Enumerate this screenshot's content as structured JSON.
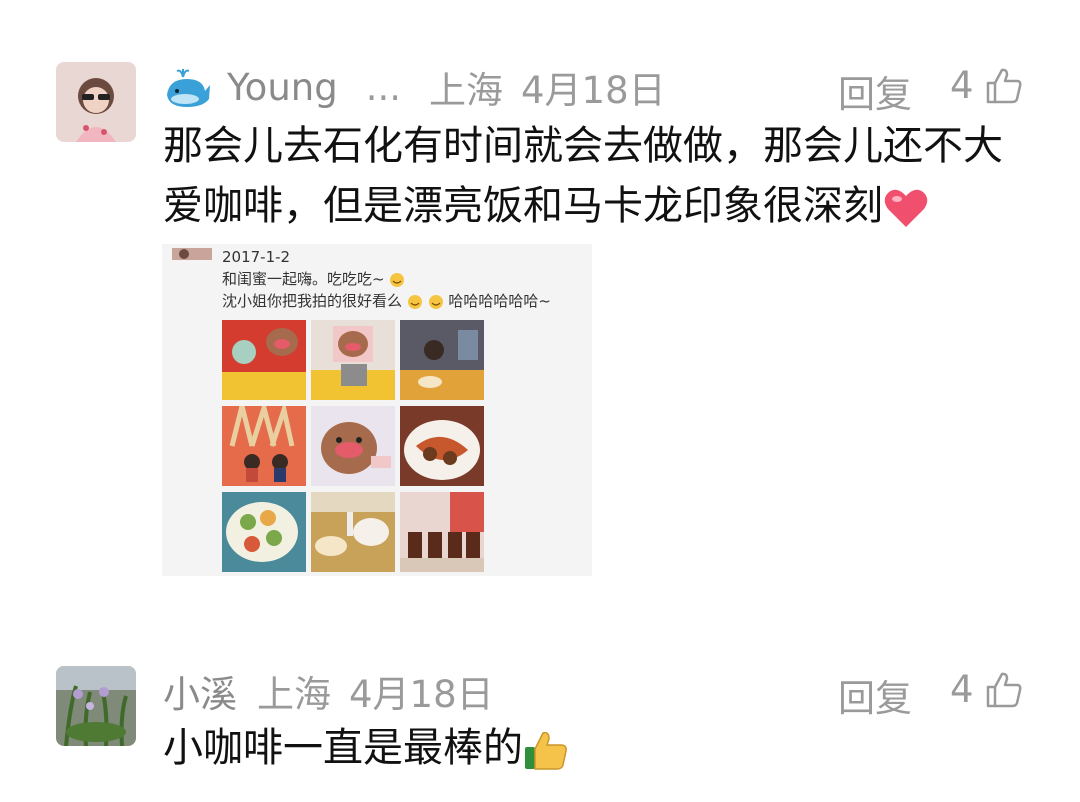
{
  "comments": [
    {
      "username": "Young",
      "ellipsis": "...",
      "location": "上海",
      "date": "4月18日",
      "reply_label": "回复",
      "likes": "4",
      "text_line1": "那会儿去石化有时间就会去做做，那会儿还不大",
      "text_line2": "爱咖啡，但是漂亮饭和马卡龙印象很深刻",
      "icons": {
        "name_badge": "whale-icon",
        "trailing_emoji": "heart-icon",
        "like": "thumbs-up-icon"
      },
      "attached_image": {
        "date": "2017-1-2",
        "line1": "和闺蜜一起嗨。吃吃吃~",
        "line2": "沈小姐你把我拍的很好看么",
        "line2_tail": "哈哈哈哈哈哈~"
      }
    },
    {
      "username": "小溪",
      "location": "上海",
      "date": "4月18日",
      "reply_label": "回复",
      "likes": "4",
      "text": "小咖啡一直是最棒的",
      "icons": {
        "trailing_emoji": "thumbs-up-emoji-icon",
        "like": "thumbs-up-icon"
      }
    }
  ],
  "colors": {
    "meta_text": "#9a9a9a",
    "body_text": "#111111",
    "heart": "#f0506e"
  }
}
